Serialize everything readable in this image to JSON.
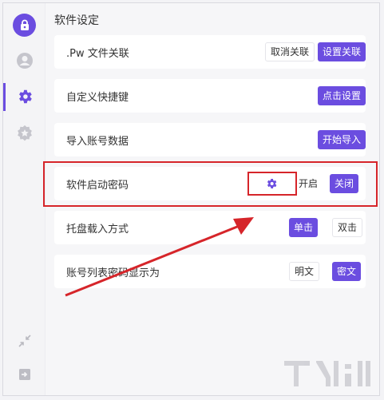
{
  "sidebar": {
    "logo_icon": "lock-badge-icon",
    "items": [
      {
        "icon": "user-icon",
        "active": false
      },
      {
        "icon": "gear-icon",
        "active": true
      },
      {
        "icon": "star-badge-icon",
        "active": false
      }
    ],
    "bottom_items": [
      {
        "icon": "shrink-arrows-icon"
      },
      {
        "icon": "exit-icon"
      }
    ]
  },
  "page": {
    "title": "软件设定"
  },
  "settings": [
    {
      "label": ".Pw 文件关联",
      "buttons": [
        "取消关联",
        "设置关联"
      ]
    },
    {
      "label": "自定义快捷键",
      "buttons": [
        "点击设置"
      ]
    },
    {
      "label": "导入账号数据",
      "buttons": [
        "开始导入"
      ]
    },
    {
      "label": "软件启动密码",
      "gear_icon": "gear-icon",
      "buttons": [
        "开启",
        "关闭"
      ]
    },
    {
      "label": "托盘载入方式",
      "buttons": [
        "单击",
        "双击"
      ]
    },
    {
      "label": "账号列表密码显示为",
      "buttons": [
        "明文",
        "密文"
      ]
    }
  ],
  "colors": {
    "accent": "#6b4de0",
    "annotation": "#d6252a"
  }
}
